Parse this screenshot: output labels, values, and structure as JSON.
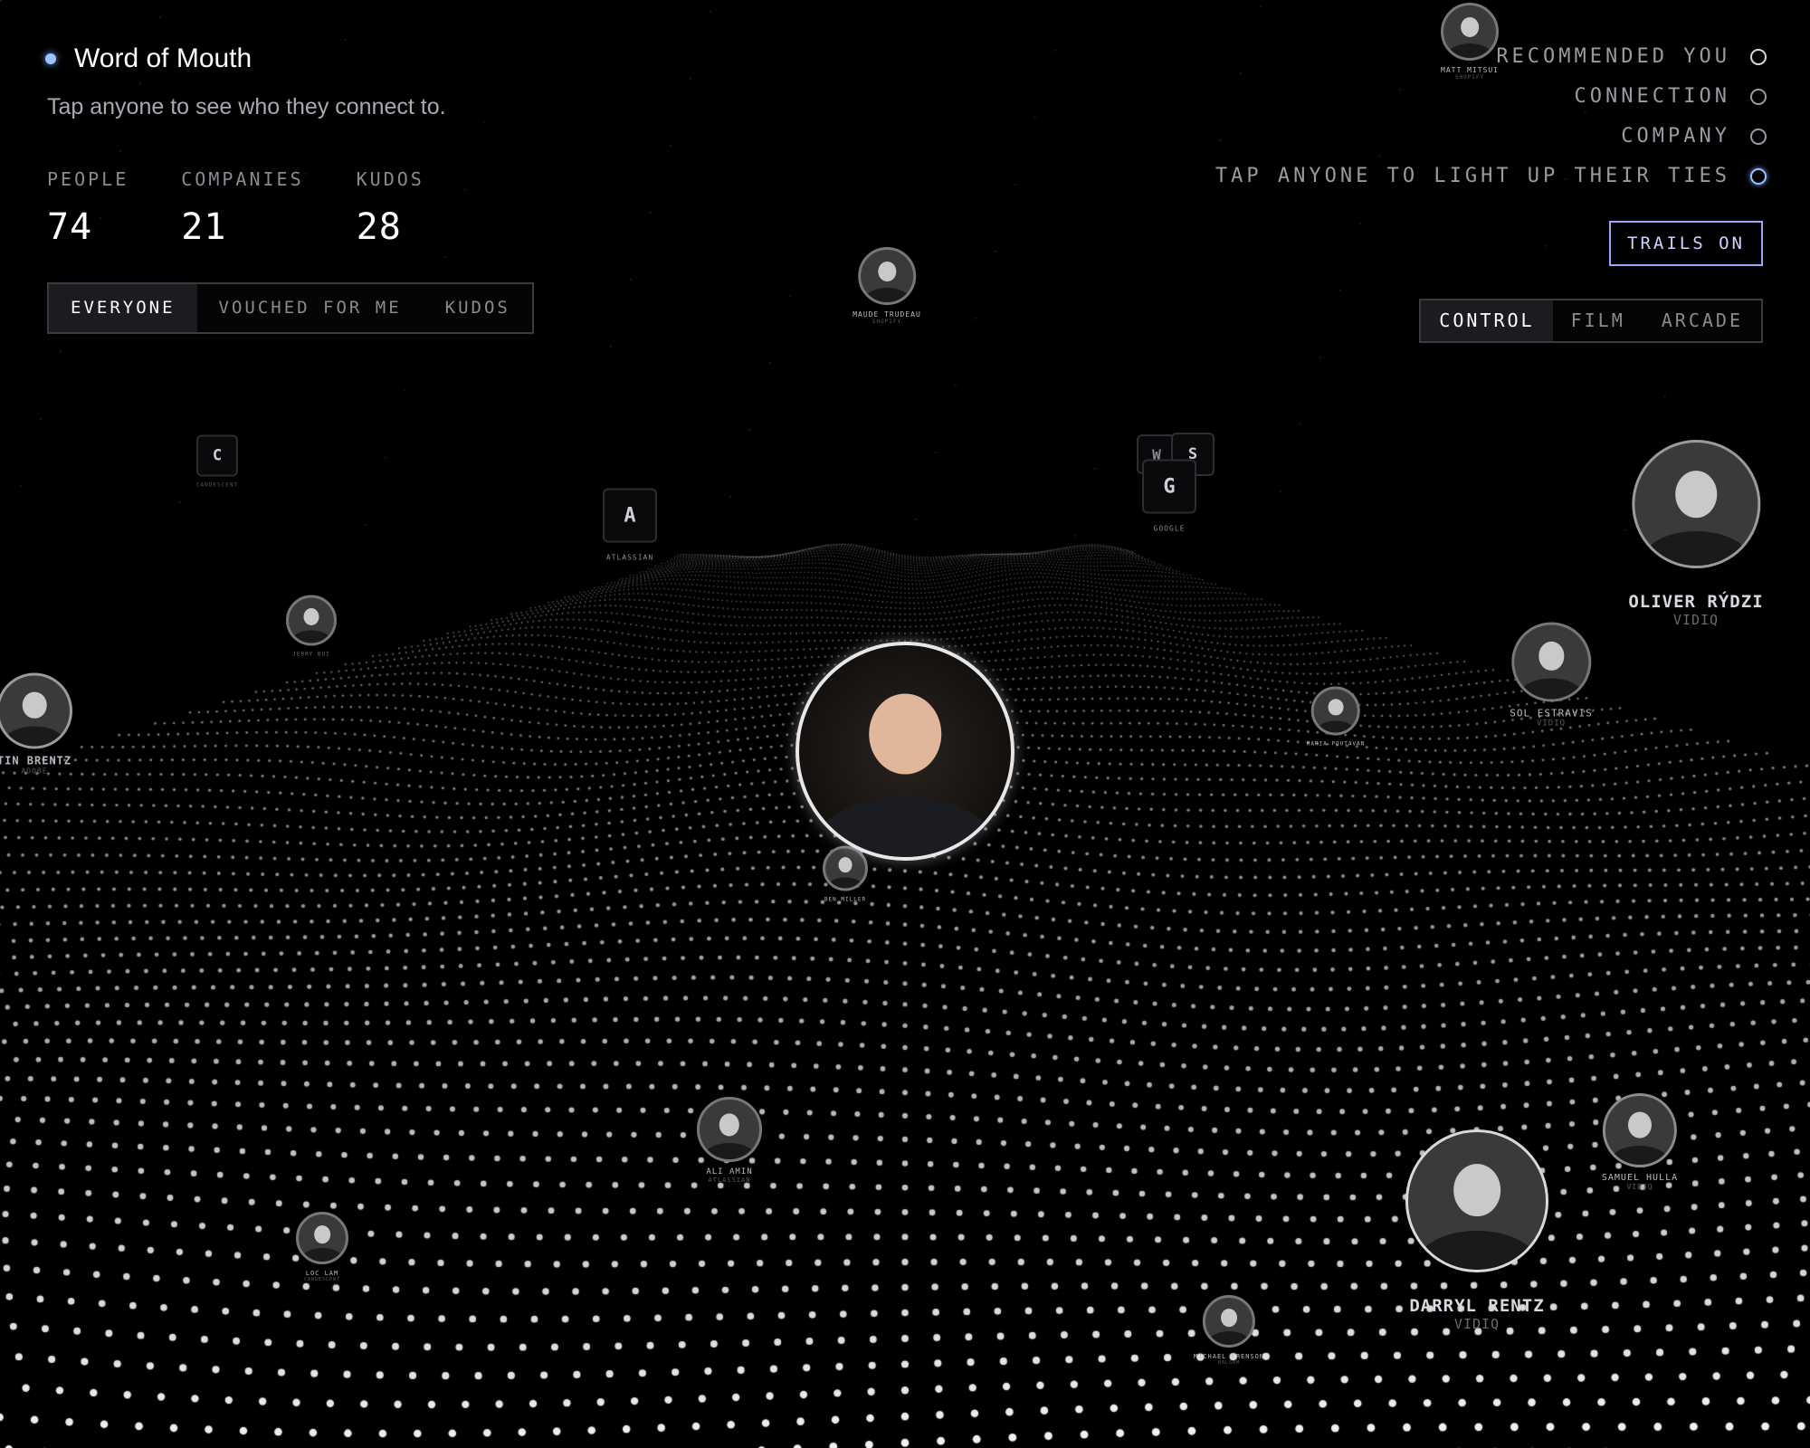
{
  "header": {
    "title": "Word of Mouth",
    "subtitle": "Tap anyone to see who they connect to."
  },
  "stats": [
    {
      "label": "PEOPLE",
      "value": "74"
    },
    {
      "label": "COMPANIES",
      "value": "21"
    },
    {
      "label": "KUDOS",
      "value": "28"
    }
  ],
  "filters": {
    "options": [
      "EVERYONE",
      "VOUCHED FOR ME",
      "KUDOS"
    ],
    "selected": "EVERYONE"
  },
  "legend": [
    {
      "label": "RECOMMENDED YOU",
      "ring": "white"
    },
    {
      "label": "CONNECTION",
      "ring": "grey"
    },
    {
      "label": "COMPANY",
      "ring": "grey"
    },
    {
      "label": "TAP ANYONE TO LIGHT UP THEIR TIES",
      "ring": "blue"
    }
  ],
  "trails_label": "TRAILS ON",
  "modes": {
    "options": [
      "CONTROL",
      "FILM",
      "ARCADE"
    ],
    "selected": "CONTROL"
  },
  "colors": {
    "accent": "#9ec2ff",
    "background": "#000000",
    "dots": "#ffffff"
  },
  "people": {
    "featured": {
      "name": "",
      "company": ""
    },
    "matt": {
      "name": "MATT MITSUI",
      "company": "SHOPIFY"
    },
    "maude": {
      "name": "MAUDE TRUDEAU",
      "company": "SHOPIFY"
    },
    "oliver": {
      "name": "OLIVER RÝDZI",
      "company": "VIDIQ"
    },
    "sol": {
      "name": "SOL ESTRAVIS",
      "company": "VIDIQ"
    },
    "maria": {
      "name": "MARIA POUTAVAN",
      "company": ""
    },
    "justin": {
      "name": "TIN BRENTZ",
      "company": "ADOBE"
    },
    "sebastian": {
      "name": "JERRY BUI",
      "company": ""
    },
    "ben": {
      "name": "BEN MILLER",
      "company": ""
    },
    "ali": {
      "name": "ALI AMIN",
      "company": "ATLASSIAN"
    },
    "loc": {
      "name": "LOC LAM",
      "company": "CANDESCENT"
    },
    "darryl": {
      "name": "DARRYL RENTZ",
      "company": "VIDIQ"
    },
    "samuel": {
      "name": "SAMUEL HULLA",
      "company": "VIDIQ"
    },
    "michael": {
      "name": "MICHAEL KRENSON",
      "company": "BALSAM"
    }
  },
  "companies": {
    "candescent": {
      "letter": "C",
      "name": "CANDESCENT"
    },
    "atlassian": {
      "letter": "A",
      "name": "ATLASSIAN"
    },
    "google": {
      "letter": "G",
      "name": "GOOGLE"
    },
    "w": {
      "letter": "W",
      "name": ""
    },
    "s": {
      "letter": "S",
      "name": ""
    }
  }
}
